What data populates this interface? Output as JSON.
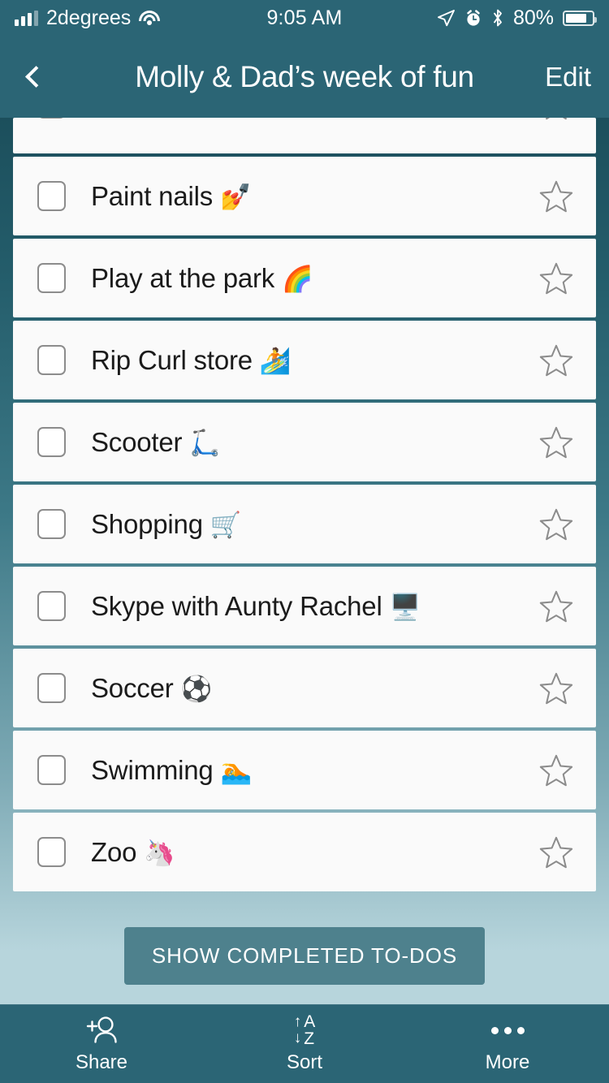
{
  "status_bar": {
    "carrier": "2degrees",
    "time": "9:05 AM",
    "battery_percent": "80%",
    "signal_icon": "signal-bars-icon",
    "wifi_icon": "wifi-icon",
    "location_icon": "location-arrow-icon",
    "alarm_icon": "alarm-clock-icon",
    "bluetooth_icon": "bluetooth-icon",
    "battery_icon": "battery-icon"
  },
  "nav": {
    "back_icon": "chevron-left-icon",
    "title": "Molly & Dad’s week of fun",
    "edit_label": "Edit"
  },
  "list": {
    "items": [
      {
        "text": "",
        "emoji": "⌨️",
        "clipped": true,
        "checked": false,
        "starred": false
      },
      {
        "text": "Paint nails",
        "emoji": "💅",
        "clipped": false,
        "checked": false,
        "starred": false
      },
      {
        "text": "Play at the park",
        "emoji": "🌈",
        "clipped": false,
        "checked": false,
        "starred": false
      },
      {
        "text": "Rip Curl store",
        "emoji": "🏄",
        "clipped": false,
        "checked": false,
        "starred": false
      },
      {
        "text": "Scooter",
        "emoji": "🛴",
        "clipped": false,
        "checked": false,
        "starred": false
      },
      {
        "text": "Shopping",
        "emoji": "🛒",
        "clipped": false,
        "checked": false,
        "starred": false
      },
      {
        "text": "Skype with Aunty Rachel",
        "emoji": "🖥️",
        "clipped": false,
        "checked": false,
        "starred": false
      },
      {
        "text": "Soccer",
        "emoji": "⚽",
        "clipped": false,
        "checked": false,
        "starred": false
      },
      {
        "text": "Swimming",
        "emoji": "🏊",
        "clipped": false,
        "checked": false,
        "starred": false
      },
      {
        "text": "Zoo",
        "emoji": "🦄",
        "clipped": false,
        "checked": false,
        "starred": false
      }
    ],
    "show_completed_label": "SHOW COMPLETED TO-DOS"
  },
  "tabbar": {
    "tabs": [
      {
        "label": "Share",
        "icon": "add-person-icon"
      },
      {
        "label": "Sort",
        "icon": "sort-az-icon"
      },
      {
        "label": "More",
        "icon": "ellipsis-icon"
      }
    ],
    "sort_up_arrow": "↑",
    "sort_down_arrow": "↓",
    "sort_letter_a": "A",
    "sort_letter_z": "Z"
  },
  "colors": {
    "header_teal": "#2b6575",
    "dark_teal": "#1f5562",
    "light_blue": "#b7d5dc",
    "button_teal": "#4e818d",
    "row_bg": "#fafafa",
    "text_dark": "#1b1b1b",
    "outline_gray": "#8c8c8c"
  }
}
